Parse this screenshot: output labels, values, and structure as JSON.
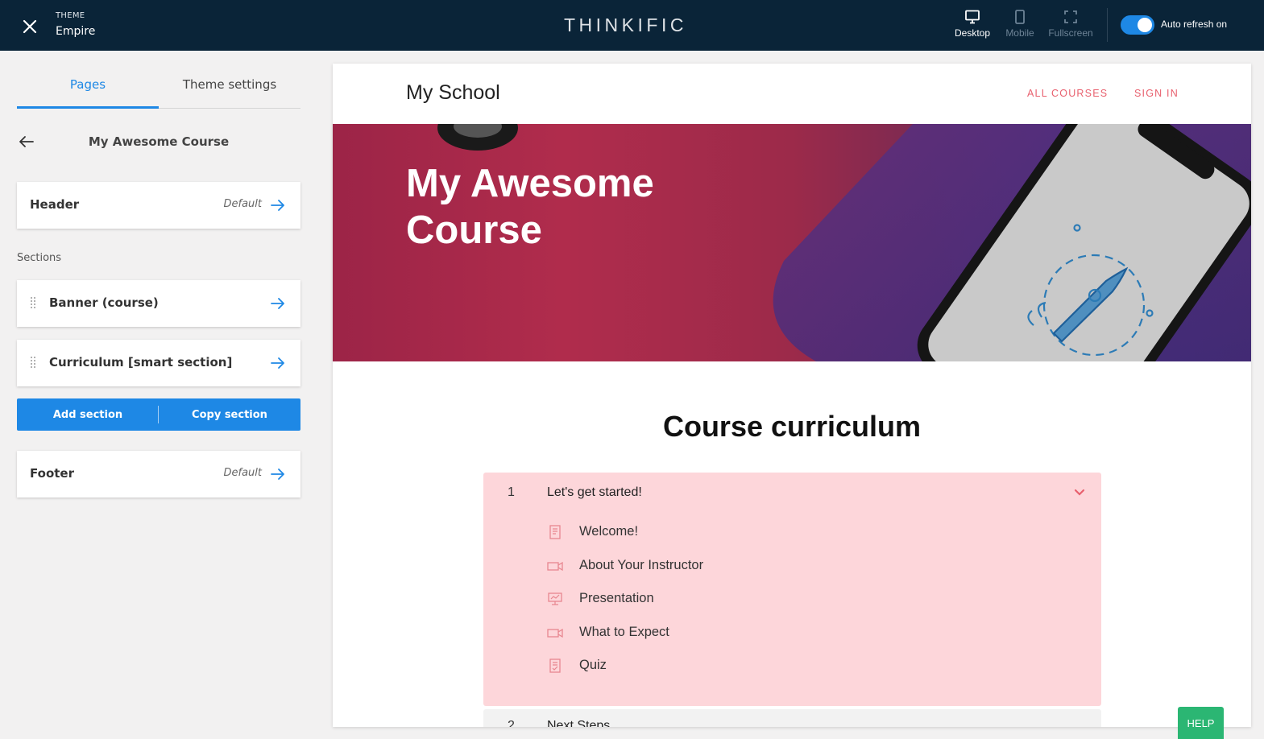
{
  "topbar": {
    "theme_label": "THEME",
    "theme_name": "Empire",
    "brand": "THINKIFIC",
    "views": {
      "desktop": "Desktop",
      "mobile": "Mobile",
      "fullscreen": "Fullscreen"
    },
    "auto_refresh_label": "Auto refresh on",
    "auto_refresh_on": true
  },
  "sidebar": {
    "tabs": {
      "pages": "Pages",
      "theme_settings": "Theme settings"
    },
    "page_name": "My Awesome Course",
    "header": {
      "title": "Header",
      "default": "Default"
    },
    "sections_label": "Sections",
    "sections": [
      {
        "title": "Banner (course)"
      },
      {
        "title": "Curriculum [smart section]"
      }
    ],
    "add_section": "Add section",
    "copy_section": "Copy section",
    "footer": {
      "title": "Footer",
      "default": "Default"
    }
  },
  "preview": {
    "school_name": "My School",
    "nav": {
      "all_courses": "ALL COURSES",
      "sign_in": "SIGN IN"
    },
    "banner_title": "My Awesome Course",
    "curriculum_title": "Course curriculum",
    "chapters": [
      {
        "number": "1",
        "title": "Let's get started!",
        "lessons": [
          {
            "icon": "text-lesson-icon",
            "label": "Welcome!"
          },
          {
            "icon": "video-lesson-icon",
            "label": "About Your Instructor"
          },
          {
            "icon": "presentation-lesson-icon",
            "label": "Presentation"
          },
          {
            "icon": "video-lesson-icon",
            "label": "What to Expect"
          },
          {
            "icon": "quiz-lesson-icon",
            "label": "Quiz"
          }
        ]
      },
      {
        "number": "2",
        "title": "Next Steps"
      }
    ]
  },
  "help_label": "HELP",
  "colors": {
    "topbar": "#0a2438",
    "accent": "#1e88e5",
    "link": "#e8606e",
    "chapter_bg": "#fdd6da",
    "help": "#2bb673"
  }
}
